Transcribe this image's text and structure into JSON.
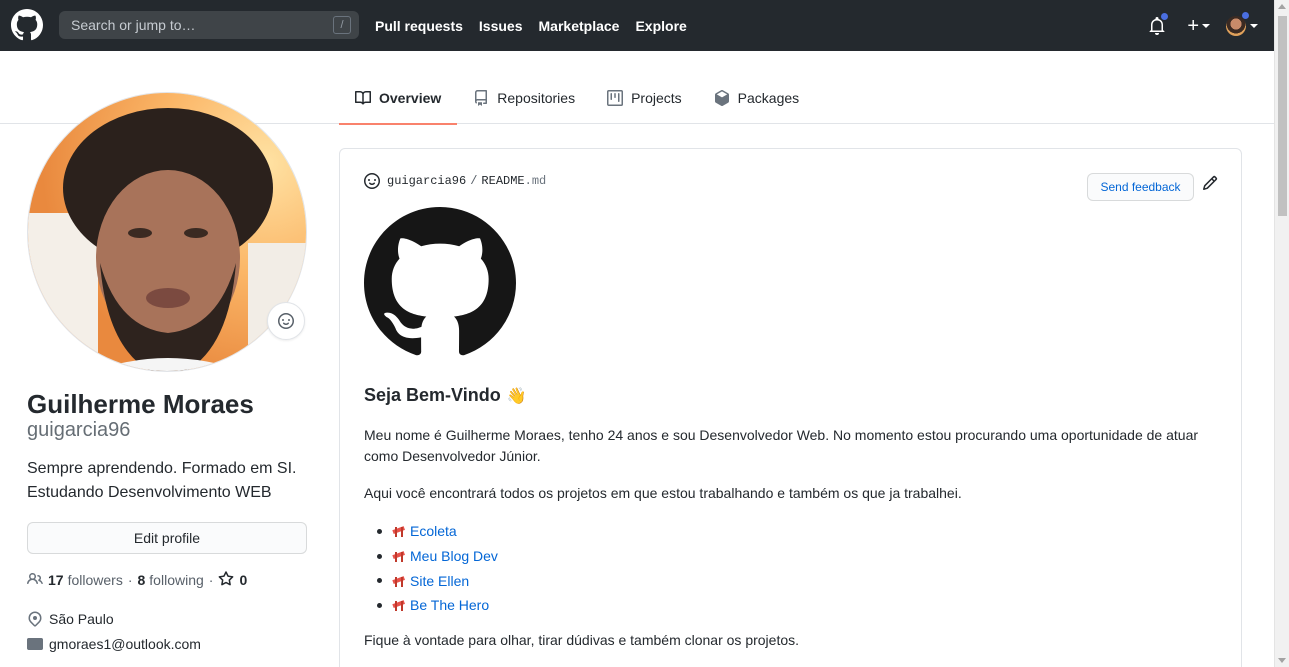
{
  "header": {
    "search_placeholder": "Search or jump to…",
    "search_shortcut": "/",
    "nav": [
      "Pull requests",
      "Issues",
      "Marketplace",
      "Explore"
    ],
    "plus_label": "+",
    "accent_color": "#4a6ee0"
  },
  "tabs": [
    {
      "label": "Overview",
      "icon": "book-icon",
      "selected": true
    },
    {
      "label": "Repositories",
      "icon": "repo-icon",
      "selected": false
    },
    {
      "label": "Projects",
      "icon": "project-icon",
      "selected": false
    },
    {
      "label": "Packages",
      "icon": "package-icon",
      "selected": false
    }
  ],
  "profile": {
    "name": "Guilherme Moraes",
    "username": "guigarcia96",
    "bio_line1": "Sempre aprendendo. Formado em SI.",
    "bio_line2": "Estudando Desenvolvimento WEB",
    "edit_label": "Edit profile",
    "followers_count": "17",
    "followers_label": "followers",
    "following_count": "8",
    "following_label": "following",
    "stars_count": "0",
    "separator": "·",
    "location": "São Paulo",
    "email": "gmoraes1@outlook.com"
  },
  "readme": {
    "owner": "guigarcia96",
    "path_sep": "/",
    "file_name": "README",
    "file_ext": ".md",
    "feedback_label": "Send feedback",
    "heading": "Seja Bem-Vindo",
    "heading_emoji": "👋",
    "paragraph1": "Meu nome é Guilherme Moraes, tenho 24 anos e sou Desenvolvedor Web. No momento estou procurando uma oportunidade de atuar como Desenvolvedor Júnior.",
    "paragraph2": "Aqui você encontrará todos os projetos em que estou trabalhando e também os que ja trabalhei.",
    "links": [
      "Ecoleta",
      "Meu Blog Dev",
      "Site Ellen",
      "Be The Hero"
    ],
    "paragraph3": "Fique à vontade para olhar, tirar dúdivas e também clonar os projetos."
  }
}
